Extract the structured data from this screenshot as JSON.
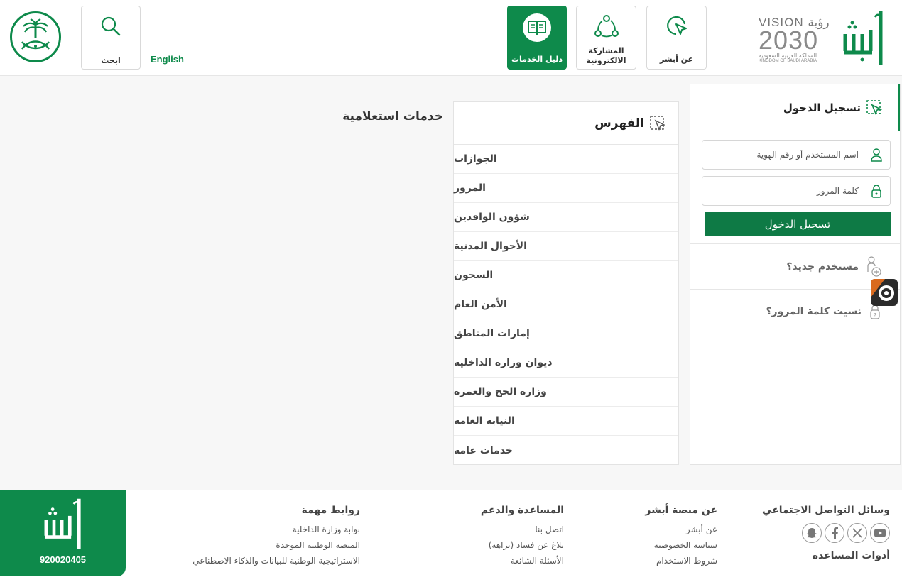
{
  "header": {
    "search_label": "ابحث",
    "english_label": "English",
    "guide_label": "دليل الخدمات",
    "participation_label_1": "المشاركة",
    "participation_label_2": "الالكترونية",
    "about_label": "عن أبشر",
    "vision_word": "VISION",
    "vision_arabic": "رؤية",
    "vision_year": "2030",
    "vision_kingdom_ar": "المملكة العربية السعودية",
    "vision_kingdom_en": "KINGDOM OF SAUDI ARABIA",
    "brand_color": "#0e8a4b"
  },
  "login": {
    "title": "تسجيل الدخول",
    "username_placeholder": "اسم المستخدم أو رقم الهوية",
    "password_placeholder": "كلمة المرور",
    "submit_label": "تسجيل الدخول",
    "new_user_label": "مستخدم جديد؟",
    "forgot_label": "نسيت كلمة المرور؟"
  },
  "index": {
    "title": "الفهرس",
    "items": [
      "الجوازات",
      "المرور",
      "شؤون الوافدين",
      "الأحوال المدنية",
      "السجون",
      "الأمن العام",
      "إمارات المناطق",
      "ديوان وزارة الداخلية",
      "وزارة الحج والعمرة",
      "النيابة العامة",
      "خدمات عامة"
    ]
  },
  "inquiry": {
    "title": "خدمات استعلامية"
  },
  "footer": {
    "phone": "920020405",
    "social_title": "وسائل التواصل الاجتماعي",
    "tools_title": "أدوات المساعدة",
    "about_title": "عن منصة أبشر",
    "about_links": [
      "عن أبشر",
      "سياسة الخصوصية",
      "شروط الاستخدام"
    ],
    "help_title": "المساعدة والدعم",
    "help_links": [
      "اتصل بنا",
      "بلاغ عن فساد (نزاهة)",
      "الأسئلة الشائعة"
    ],
    "links_title": "روابط مهمة",
    "important_links": [
      "بوابة وزارة الداخلية",
      "المنصة الوطنية الموحدة",
      "الاستراتيجية الوطنية للبيانات والذكاء الاصطناعي"
    ],
    "social_icons": [
      "snapchat-icon",
      "facebook-icon",
      "x-icon",
      "youtube-icon"
    ]
  }
}
